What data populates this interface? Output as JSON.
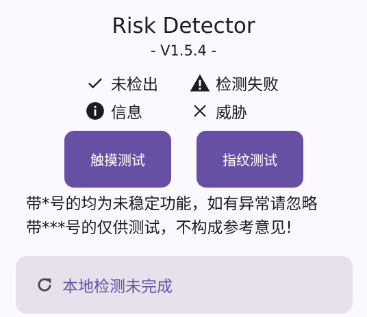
{
  "app": {
    "title": "Risk Detector",
    "version": "- V1.5.4 -"
  },
  "legend": {
    "not_detected": {
      "icon": "check-icon",
      "label": "未检出"
    },
    "detect_failed": {
      "icon": "warning-icon",
      "label": "检测失败"
    },
    "info": {
      "icon": "info-icon",
      "label": "信息"
    },
    "threat": {
      "icon": "close-icon",
      "label": "威胁"
    }
  },
  "buttons": {
    "touch_test": "触摸测试",
    "fingerprint_test": "指纹测试"
  },
  "notice": {
    "line1": "带*号的均为未稳定功能，如有异常请忽略",
    "line2": "带***号的仅供测试，不构成参考意见!"
  },
  "status_card": {
    "icon": "refresh-icon",
    "label": "本地检测未完成"
  },
  "colors": {
    "accent": "#6750a4",
    "background": "#fcf8ff",
    "card": "#e6e1ea",
    "text": "#1c1b1f"
  }
}
